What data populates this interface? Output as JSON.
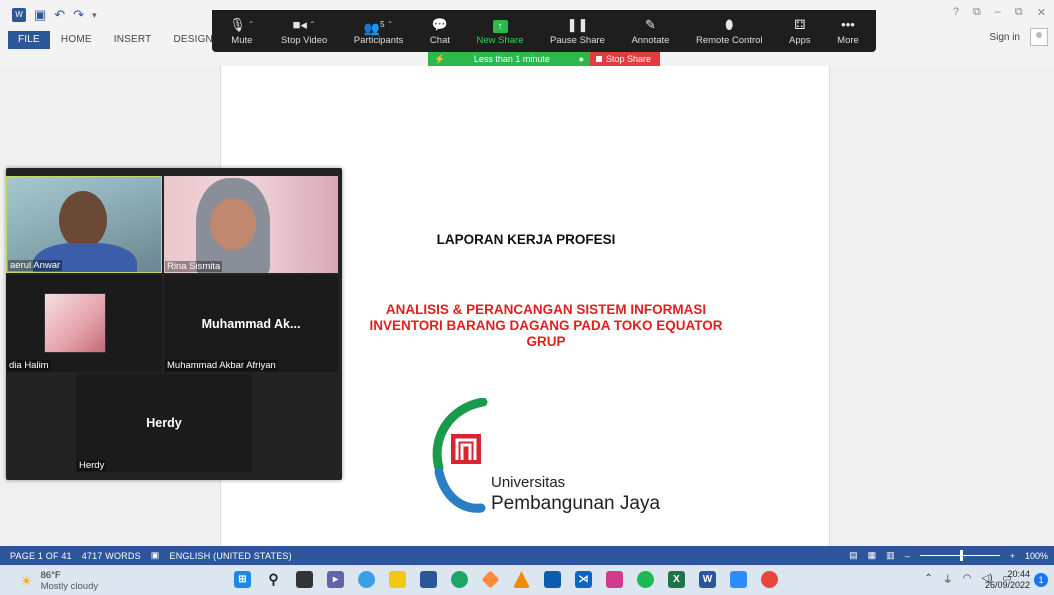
{
  "word": {
    "quick_access": [
      "W",
      "💾",
      "↶",
      "↷",
      "⌄"
    ],
    "tabs": [
      "FILE",
      "HOME",
      "INSERT",
      "DESIGN"
    ],
    "window_controls": [
      "?",
      "⧉",
      "–",
      "⧉",
      "✕"
    ],
    "sign_in": "Sign in"
  },
  "zoom_toolbar": {
    "items": [
      {
        "label": "Mute",
        "icon": "🎤"
      },
      {
        "label": "Stop Video",
        "icon": "▮◂"
      },
      {
        "label": "Participants",
        "icon": "👥",
        "count": "5"
      },
      {
        "label": "Chat",
        "icon": "💬"
      },
      {
        "label": "New Share",
        "icon": "↑"
      },
      {
        "label": "Pause Share",
        "icon": "❚❚"
      },
      {
        "label": "Annotate",
        "icon": "✎"
      },
      {
        "label": "Remote Control",
        "icon": "⬮"
      },
      {
        "label": "Apps",
        "icon": "⚃"
      },
      {
        "label": "More",
        "icon": "•••"
      }
    ],
    "share_time": "Less than 1 minute",
    "stop_share": "Stop Share"
  },
  "document": {
    "title": "LAPORAN KERJA PROFESI",
    "subtitle_line1": "ANALISIS & PERANCANGAN SISTEM INFORMASI",
    "subtitle_line2": "INVENTORI BARANG DAGANG PADA TOKO EQUATOR",
    "subtitle_line3": "GRUP",
    "university_line1": "Universitas",
    "university_line2": "Pembangunan Jaya"
  },
  "gallery": {
    "tiles": [
      {
        "name": "aerul Anwar"
      },
      {
        "name": "Rina Sismita"
      },
      {
        "name": "dia Halim"
      },
      {
        "name": "Muhammad Akbar Afriyan",
        "big": "Muhammad Ak..."
      },
      {
        "name": "Herdy",
        "big": "Herdy"
      }
    ]
  },
  "statusbar": {
    "page": "PAGE 1 OF 41",
    "words": "4717 WORDS",
    "language": "ENGLISH (UNITED STATES)",
    "zoom": "100%"
  },
  "taskbar": {
    "temperature": "86°F",
    "weather": "Mostly cloudy",
    "time": "20:44",
    "date": "26/09/2022",
    "notifications": "1"
  },
  "colors": {
    "word_blue": "#2b579a",
    "zoom_green": "#2db84d",
    "stop_red": "#e23d3d",
    "title_red": "#e02020"
  }
}
